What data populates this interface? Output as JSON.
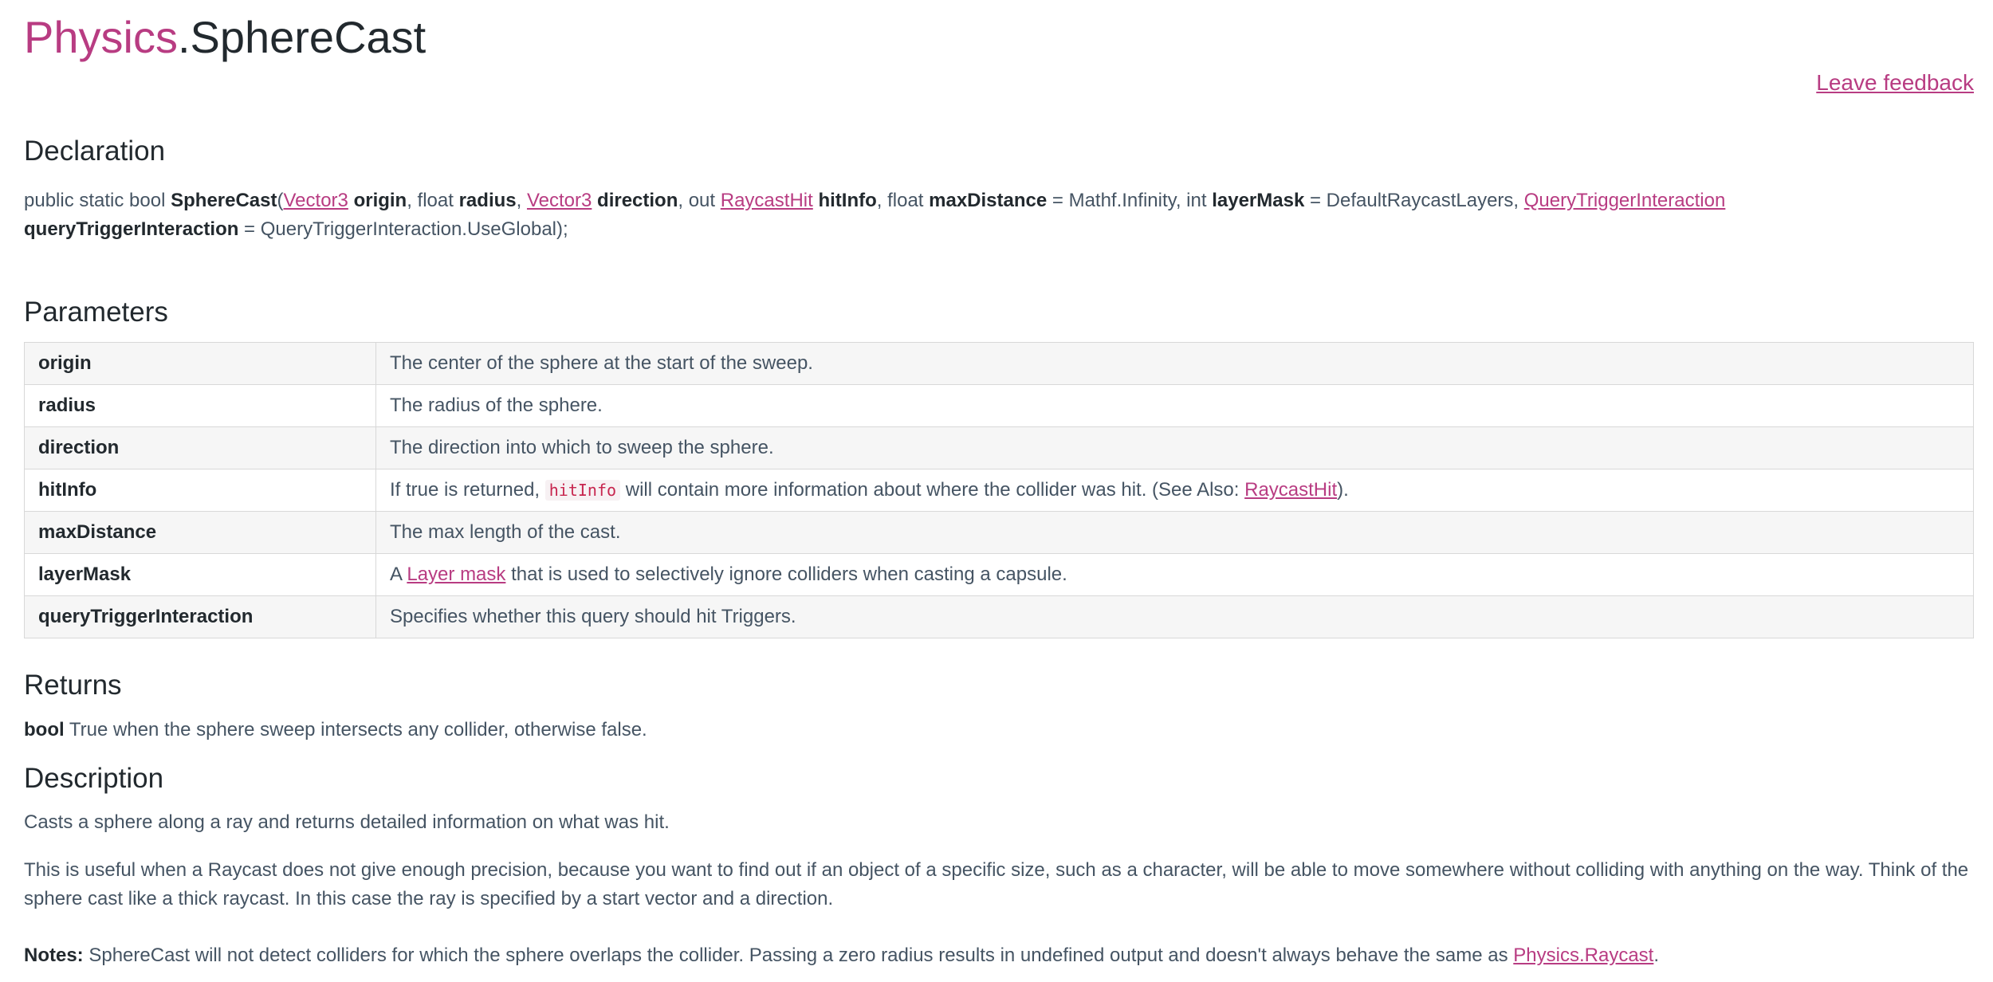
{
  "header": {
    "class_name": "Physics",
    "method_name": ".SphereCast",
    "feedback_link": "Leave feedback"
  },
  "declaration": {
    "heading": "Declaration",
    "prefix": "public static bool ",
    "method": "SphereCast",
    "open_paren": "(",
    "p1_type": "Vector3",
    "p1_name": "origin",
    "sep1": ", float ",
    "p2_name": "radius",
    "sep2": ", ",
    "p3_type": "Vector3",
    "p3_name": "direction",
    "sep3": ", out ",
    "p4_type": "RaycastHit",
    "p4_name": "hitInfo",
    "sep4": ", float ",
    "p5_name": "maxDistance",
    "p5_default": " = Mathf.Infinity, int ",
    "p6_name": "layerMask",
    "p6_default": " = DefaultRaycastLayers, ",
    "p7_type": "QueryTriggerInteraction",
    "p7_name": "queryTriggerInteraction",
    "p7_default": " = QueryTriggerInteraction.UseGlobal);"
  },
  "parameters": {
    "heading": "Parameters",
    "rows": [
      {
        "name": "origin",
        "desc": "The center of the sphere at the start of the sweep."
      },
      {
        "name": "radius",
        "desc": "The radius of the sphere."
      },
      {
        "name": "direction",
        "desc": "The direction into which to sweep the sphere."
      },
      {
        "name": "hitInfo",
        "desc_before": "If true is returned, ",
        "code": "hitInfo",
        "desc_middle": " will contain more information about where the collider was hit. (See Also: ",
        "link": "RaycastHit",
        "desc_after": ")."
      },
      {
        "name": "maxDistance",
        "desc": "The max length of the cast."
      },
      {
        "name": "layerMask",
        "desc_before": "A ",
        "link": "Layer mask",
        "desc_after": " that is used to selectively ignore colliders when casting a capsule."
      },
      {
        "name": "queryTriggerInteraction",
        "desc": "Specifies whether this query should hit Triggers."
      }
    ]
  },
  "returns": {
    "heading": "Returns",
    "type": "bool",
    "text": " True when the sphere sweep intersects any collider, otherwise false."
  },
  "description": {
    "heading": "Description",
    "para1": "Casts a sphere along a ray and returns detailed information on what was hit.",
    "para2": "This is useful when a Raycast does not give enough precision, because you want to find out if an object of a specific size, such as a character, will be able to move somewhere without colliding with anything on the way. Think of the sphere cast like a thick raycast. In this case the ray is specified by a start vector and a direction.",
    "notes_label": "Notes:",
    "notes_text": " SphereCast will not detect colliders for which the sphere overlaps the collider. Passing a zero radius results in undefined output and doesn't always behave the same as ",
    "notes_link": "Physics.Raycast",
    "notes_end": "."
  }
}
